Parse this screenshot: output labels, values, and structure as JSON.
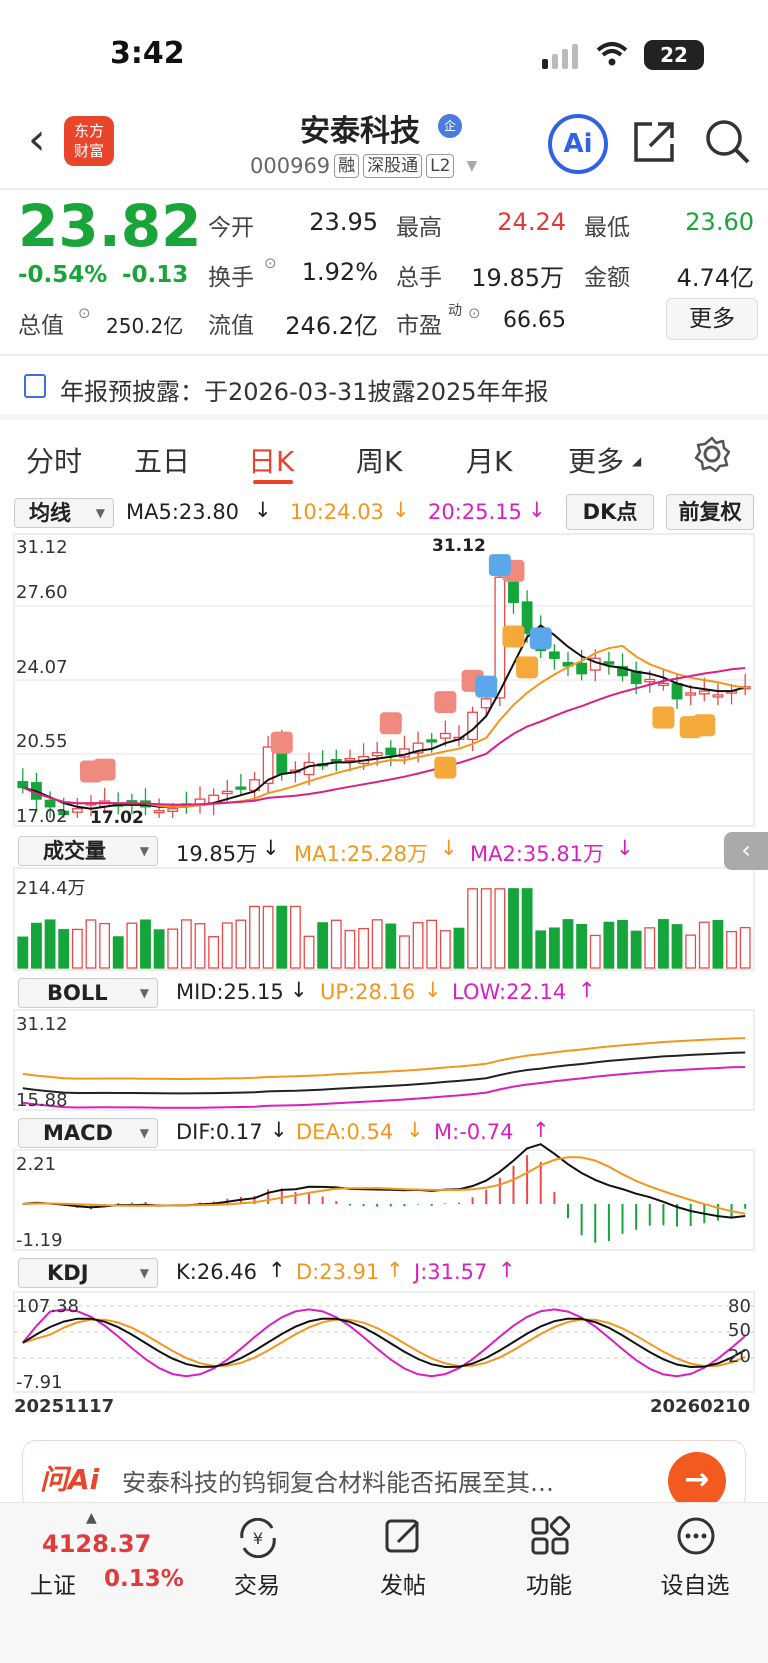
{
  "status": {
    "time": "3:42",
    "battery": "22"
  },
  "header": {
    "logo_line1": "东方",
    "logo_line2": "财富",
    "stock_name": "安泰科技",
    "badge": "企",
    "code": "000969",
    "tags": [
      "融",
      "深股通",
      "L2"
    ],
    "ai_label": "Ai"
  },
  "quote": {
    "price": "23.82",
    "change_pct": "-0.54%",
    "change": "-0.13",
    "total_value_label": "总值",
    "total_value": "250.2亿",
    "open_label": "今开",
    "open": "23.95",
    "high_label": "最高",
    "high": "24.24",
    "low_label": "最低",
    "low": "23.60",
    "turnover_label": "换手",
    "turnover": "1.92%",
    "volume_label": "总手",
    "volume": "19.85万",
    "amount_label": "金额",
    "amount": "4.74亿",
    "float_label": "流值",
    "float_value": "246.2亿",
    "pe_label": "市盈",
    "pe_sup": "动",
    "pe": "66.65",
    "more_label": "更多"
  },
  "notice": "年报预披露：于2026-03-31披露2025年年报",
  "tabs": [
    "分时",
    "五日",
    "日K",
    "周K",
    "月K",
    "更多"
  ],
  "active_tab": "日K",
  "chart_controls": {
    "ma_select": "均线",
    "ma5": "MA5:23.80",
    "ma10": "10:24.03",
    "ma20": "20:25.15",
    "dk_label": "DK点",
    "fq_label": "前复权",
    "vol_select": "成交量",
    "vol_now": "19.85万",
    "vol_ma1": "MA1:25.28万",
    "vol_ma2": "MA2:35.81万",
    "boll_select": "BOLL",
    "boll_mid": "MID:25.15",
    "boll_up": "UP:28.16",
    "boll_low": "LOW:22.14",
    "macd_select": "MACD",
    "macd_dif": "DIF:0.17",
    "macd_dea": "DEA:0.54",
    "macd_m": "M:-0.74",
    "kdj_select": "KDJ",
    "kdj_k": "K:26.46",
    "kdj_d": "D:23.91",
    "kdj_j": "J:31.57"
  },
  "chart_data": {
    "type": "candlestick",
    "price_axis": [
      "31.12",
      "27.60",
      "24.07",
      "20.55",
      "17.02"
    ],
    "max_label": "31.12",
    "min_label": "17.02",
    "vol_axis_top": "214.4万",
    "boll_axis": [
      "31.12",
      "15.88"
    ],
    "macd_axis": [
      "2.21",
      "-1.19"
    ],
    "kdj_axis": [
      "107.38",
      "-7.91"
    ],
    "kdj_levels": [
      "80",
      "50",
      "20"
    ],
    "date_start": "20251117",
    "date_end": "20260210",
    "close": [
      18.6,
      18.0,
      17.6,
      17.2,
      17.5,
      17.8,
      17.9,
      17.7,
      17.8,
      17.6,
      17.4,
      17.5,
      17.7,
      18.0,
      18.2,
      18.4,
      18.6,
      19.0,
      20.7,
      19.3,
      19.5,
      19.9,
      19.8,
      20.0,
      20.1,
      20.2,
      20.4,
      20.3,
      20.6,
      20.9,
      21.0,
      21.4,
      21.2,
      22.5,
      23.2,
      29.5,
      28.2,
      26.6,
      25.7,
      25.3,
      24.9,
      24.5,
      25.3,
      25.0,
      24.4,
      24.0,
      24.2,
      24.0,
      23.2,
      23.5,
      23.6,
      23.4,
      23.6,
      23.82
    ],
    "ma5": [
      18.6,
      18.4,
      18.1,
      17.8,
      17.6,
      17.5,
      17.6,
      17.7,
      17.7,
      17.7,
      17.6,
      17.6,
      17.6,
      17.7,
      17.8,
      18.0,
      18.2,
      18.4,
      19.0,
      19.3,
      19.4,
      19.7,
      19.8,
      19.9,
      19.9,
      20.0,
      20.1,
      20.2,
      20.3,
      20.5,
      20.6,
      20.9,
      21.1,
      21.6,
      22.3,
      23.6,
      25.0,
      26.4,
      27.0,
      26.5,
      25.9,
      25.4,
      25.1,
      24.9,
      24.8,
      24.6,
      24.5,
      24.3,
      24.0,
      23.8,
      23.7,
      23.6,
      23.6,
      23.8
    ],
    "markers": {
      "B": 7,
      "S": 3,
      "T": 6
    }
  }
}
